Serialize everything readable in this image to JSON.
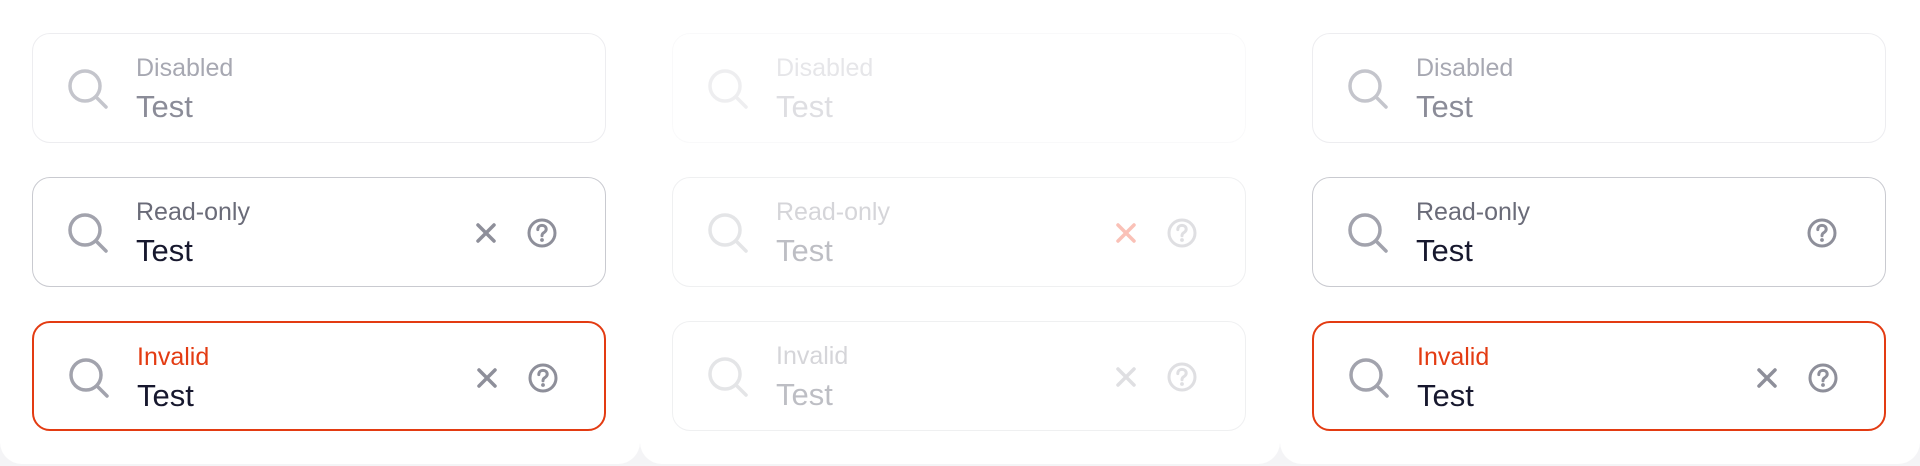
{
  "colors": {
    "border": "#c9cad0",
    "border_disabled": "#ededf0",
    "invalid": "#e33b12",
    "icon": "#a2a3ad",
    "clear_focused": "#f02300",
    "text": "#17182e",
    "label": "#6a6b78"
  },
  "columns": [
    {
      "fields": [
        {
          "label": "Disabled",
          "value": "Test",
          "icon": "search-icon"
        },
        {
          "label": "Read-only",
          "value": "Test",
          "icons": [
            "search-icon",
            "close-icon",
            "help-circle-icon"
          ]
        },
        {
          "label": "Invalid",
          "value": "Test",
          "icons": [
            "search-icon",
            "close-icon",
            "help-circle-icon"
          ]
        }
      ]
    },
    {
      "fields": [
        {
          "label": "Disabled",
          "value": "Test",
          "icon": "search-icon"
        },
        {
          "label": "Read-only",
          "value": "Test",
          "icons": [
            "search-icon",
            "close-icon",
            "help-circle-icon"
          ]
        },
        {
          "label": "Invalid",
          "value": "Test",
          "icons": [
            "search-icon",
            "close-icon",
            "help-circle-icon"
          ]
        }
      ]
    },
    {
      "fields": [
        {
          "label": "Disabled",
          "value": "Test",
          "icon": "search-icon"
        },
        {
          "label": "Read-only",
          "value": "Test",
          "icons": [
            "search-icon",
            "help-circle-icon"
          ]
        },
        {
          "label": "Invalid",
          "value": "Test",
          "icons": [
            "search-icon",
            "close-icon",
            "help-circle-icon"
          ]
        }
      ]
    }
  ]
}
